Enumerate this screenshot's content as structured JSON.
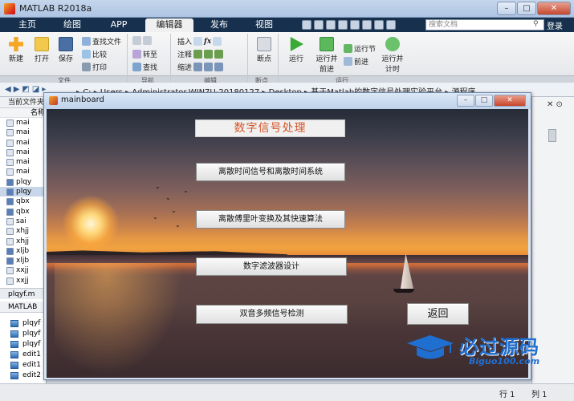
{
  "window": {
    "title": "MATLAB R2018a",
    "min": "–",
    "max": "□",
    "close": "✕"
  },
  "tabs": [
    {
      "label": "主页"
    },
    {
      "label": "绘图"
    },
    {
      "label": "APP"
    },
    {
      "label": "编辑器"
    },
    {
      "label": "发布"
    },
    {
      "label": "视图"
    }
  ],
  "search": {
    "placeholder": "搜索文档",
    "login": "登录"
  },
  "ribbon": {
    "new": "新建",
    "open": "打开",
    "save": "保存",
    "find_files": "查找文件",
    "compare": "比较",
    "print": "打印",
    "goto": "转至",
    "find": "查找",
    "insert": "插入",
    "comment": "注释",
    "indent": "缩进",
    "breakpoints": "断点",
    "run": "运行",
    "run_advance": "运行并\n前进",
    "run_section": "运行节",
    "advance": "前进",
    "run_time": "运行并\n计时",
    "groups": {
      "file": "文件",
      "navigate": "导航",
      "edit": "编辑",
      "breakpoint": "断点",
      "run": "运行"
    }
  },
  "address": {
    "path": "▸ C: ▸ Users ▸ Administrator.WIN7U-20180127 ▸ Desktop ▸ 基于Matlab的数字信号处理实验平台 ▸ 源程序"
  },
  "file_panel": {
    "header": "当前文件夹",
    "column": "名称",
    "items": [
      "mai",
      "mai",
      "mai",
      "mai",
      "mai",
      "mai",
      "plqy",
      "plqy",
      "qbx",
      "qbx",
      "sai",
      "xhjj",
      "xhjj",
      "xljb",
      "xljb",
      "xxjj",
      "xxjj"
    ],
    "selected_index": 7,
    "status": "plqyf.m",
    "workspace": "MATLAB",
    "ws_items": [
      "plqyf",
      "plqyf",
      "plqyf",
      "edit1",
      "edit1",
      "edit2"
    ]
  },
  "statusbar": {
    "row": "行 1",
    "col": "列 1"
  },
  "figure": {
    "title": "mainboard",
    "heading": "数字信号处理",
    "buttons": {
      "b1": "离散时间信号和离散时间系统",
      "b2": "离散傅里叶变换及其快速算法",
      "b3": "数字滤波器设计",
      "b4": "双音多频信号检测",
      "back": "返回"
    }
  },
  "watermark": {
    "text": "必过源码",
    "url": "Biguo100.com"
  }
}
